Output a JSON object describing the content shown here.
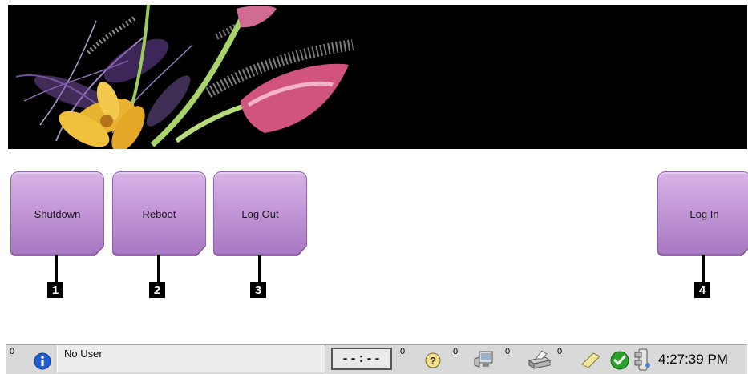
{
  "buttons": [
    {
      "id": "shutdown",
      "label": "Shutdown",
      "callout": "1"
    },
    {
      "id": "reboot",
      "label": "Reboot",
      "callout": "2"
    },
    {
      "id": "logout",
      "label": "Log Out",
      "callout": "3"
    },
    {
      "id": "login",
      "label": "Log In",
      "callout": "4"
    }
  ],
  "taskbar": {
    "alerts_count": "0",
    "user": "No User",
    "timer": "--:--",
    "help_count": "0",
    "device_count": "0",
    "print_count": "0",
    "notes_count": "0",
    "clock": "4:27:39 PM"
  },
  "colors": {
    "button_fill": "#c497d8",
    "banner_bg": "#000000",
    "taskbar_bg": "#d9d9d9",
    "info_blue": "#1f5fd1",
    "status_green": "#2aa32a"
  },
  "icons": [
    "info-icon",
    "help-icon",
    "device-icon",
    "printer-icon",
    "notes-icon",
    "ok-status-icon",
    "system-icon"
  ]
}
